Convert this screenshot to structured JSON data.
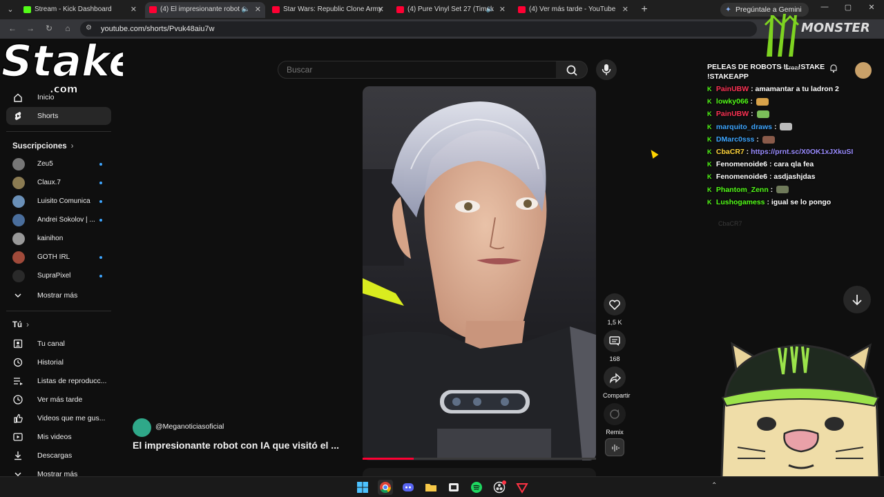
{
  "browser": {
    "tabs": [
      {
        "title": "Stream - Kick Dashboard",
        "favicon_color": "#53fc18",
        "active": false
      },
      {
        "title": "(4) El impresionante robot c",
        "favicon_color": "#ff0033",
        "active": true
      },
      {
        "title": "Star Wars: Republic Clone Army",
        "favicon_color": "#ff0033",
        "active": false
      },
      {
        "title": "(4) Pure Vinyl Set 27 (Timek",
        "favicon_color": "#ff0033",
        "active": false
      },
      {
        "title": "(4) Ver más tarde - YouTube",
        "favicon_color": "#ff0033",
        "active": false
      }
    ],
    "gemini_label": "Pregúntale a Gemini",
    "url": "youtube.com/shorts/Pvuk48aiu7w"
  },
  "youtube": {
    "search_placeholder": "Buscar",
    "create_label": "Crear",
    "sidebar": {
      "main": [
        {
          "label": "Inicio",
          "icon": "home-icon"
        },
        {
          "label": "Shorts",
          "icon": "shorts-icon",
          "selected": true
        }
      ],
      "subscriptions_title": "Suscripciones",
      "subscriptions": [
        {
          "label": "Zeu5",
          "color": "#777"
        },
        {
          "label": "Claux.7",
          "color": "#8b7b52"
        },
        {
          "label": "Luisito Comunica",
          "color": "#6a90b8"
        },
        {
          "label": "Andrei Sokolov | ...",
          "color": "#4a6e9c"
        },
        {
          "label": "kainihon",
          "color": "#999"
        },
        {
          "label": "GOTH IRL",
          "color": "#a04a3a"
        },
        {
          "label": "SupraPixel",
          "color": "#2a2a2a"
        }
      ],
      "show_more": "Mostrar más",
      "you_title": "Tú",
      "you_items": [
        {
          "label": "Tu canal",
          "icon": "channel-icon"
        },
        {
          "label": "Historial",
          "icon": "history-icon"
        },
        {
          "label": "Listas de reproducc...",
          "icon": "playlist-icon"
        },
        {
          "label": "Ver más tarde",
          "icon": "clock-icon"
        },
        {
          "label": "Videos que me gus...",
          "icon": "thumbs-up-icon"
        },
        {
          "label": "Mis videos",
          "icon": "video-icon"
        },
        {
          "label": "Descargas",
          "icon": "download-icon"
        },
        {
          "label": "Mostrar más",
          "icon": "chevron-down-icon"
        }
      ]
    },
    "short": {
      "channel": "@Meganoticiasoficial",
      "title": "El impresionante robot con IA que visitó el ...",
      "likes": "1,5 K",
      "comments": "168",
      "share_label": "Compartir",
      "remix_label": "Remix",
      "progress": 0.22
    }
  },
  "stream_overlay": {
    "chat_title": "PELEAS DE ROBOTS !L... !STAKE !STAKEAPP",
    "chat": [
      {
        "user": "PainUBW",
        "user_color": "#ff3355",
        "message": "amamantar a tu ladron 2"
      },
      {
        "user": "lowky066",
        "user_color": "#53fc18",
        "message": "",
        "emote_color": "#d8a24a"
      },
      {
        "user": "PainUBW",
        "user_color": "#ff3355",
        "message": "",
        "emote_color": "#7bbf5a"
      },
      {
        "user": "marquito_draws",
        "user_color": "#3ea6ff",
        "message": "",
        "emote_color": "#bbbbbb"
      },
      {
        "user": "DMarc0sss",
        "user_color": "#3ea6ff",
        "message": "",
        "emote_color": "#8a5b4a"
      },
      {
        "user": "CbaCR7",
        "user_color": "#ffd43b",
        "message": "https://prnt.sc/X0OK1xJXkuSI",
        "is_link": true
      },
      {
        "user": "Fenomenoide6",
        "user_color": "#ffffff",
        "message": "cara qla fea"
      },
      {
        "user": "Fenomenoide6",
        "user_color": "#ffffff",
        "message": "asdjashjdas"
      },
      {
        "user": "Phantom_Zenn",
        "user_color": "#53fc18",
        "message": "",
        "emote_color": "#6f7a5a"
      },
      {
        "user": "Lushogamess",
        "user_color": "#53fc18",
        "message": "igual se lo pongo"
      }
    ],
    "ghost_user": "CbaCR7"
  }
}
